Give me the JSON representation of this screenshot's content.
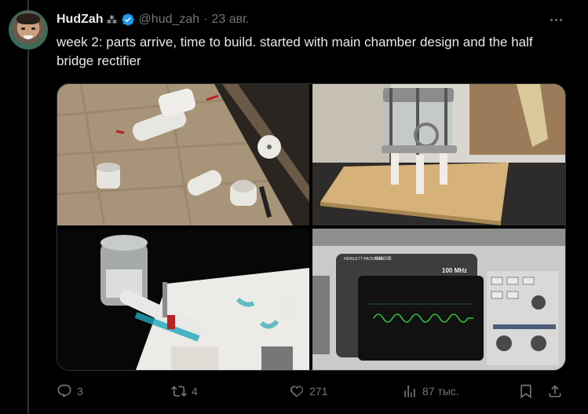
{
  "tweet": {
    "display_name": "HudZah",
    "name_emoji": "⁂",
    "handle": "@hud_zah",
    "separator": "·",
    "date": "23 авг.",
    "text": "week 2: parts arrive, time to build. started with main chamber design and the half bridge rectifier"
  },
  "media": {
    "photos": [
      {
        "subject": "white PVC parts on plywood"
      },
      {
        "subject": "glass chamber with metal rods on wooden board"
      },
      {
        "subject": "PVC cement can and pipe on paper towel"
      },
      {
        "subject": "oscilloscope showing waveform"
      }
    ],
    "oscilloscope_brand": "HEWLETT PACKARD",
    "oscilloscope_model": "54600B",
    "oscilloscope_bandwidth": "100 MHz"
  },
  "actions": {
    "replies": "3",
    "reposts": "4",
    "likes": "271",
    "views": "87 тыс."
  },
  "colors": {
    "background": "#000000",
    "text": "#e7e9ea",
    "muted": "#71767b",
    "verified": "#1d9bf0"
  }
}
